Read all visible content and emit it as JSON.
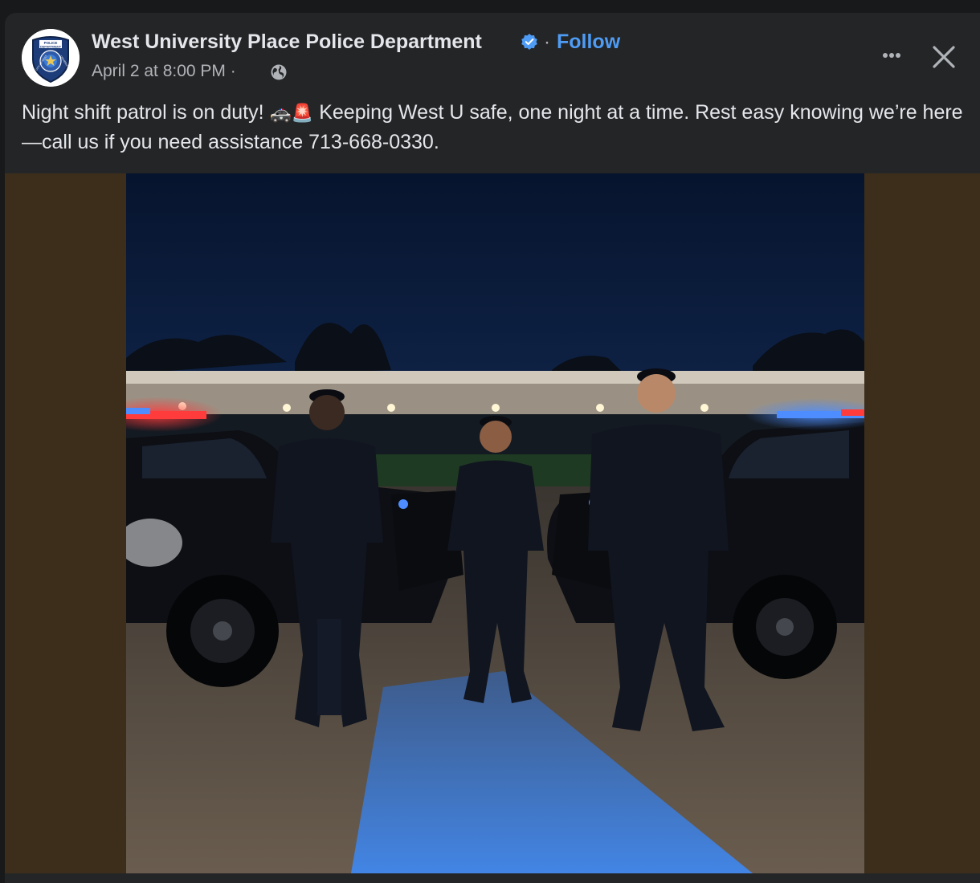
{
  "post": {
    "page_name": "West University Place Police Department",
    "separator": "·",
    "follow_label": "Follow",
    "timestamp": "April 2 at 8:00 PM",
    "meta_separator": "·",
    "audience_icon": "globe-icon",
    "text_part1": "Night shift patrol is on duty! ",
    "emoji_1": "🚓🚨",
    "text_part2": " Keeping West U safe, one night at a time. Rest easy knowing we’re here—call us if you need assistance 713-668-0330."
  },
  "icons": {
    "verified": "verified-badge-icon",
    "more": "more-options-icon",
    "close": "close-icon"
  },
  "avatar": {
    "badge_text_top": "POLICE",
    "badge_text_line2": "DEPARTMENT",
    "badge_text_left": "CITY OF WEST",
    "badge_text_right": "UNIVERSITY"
  },
  "colors": {
    "background": "#18191a",
    "card": "#242526",
    "text_primary": "#e4e6eb",
    "text_secondary": "#b0b3b8",
    "accent": "#4e9cf5",
    "photo_matte": "#3c2e1b"
  }
}
